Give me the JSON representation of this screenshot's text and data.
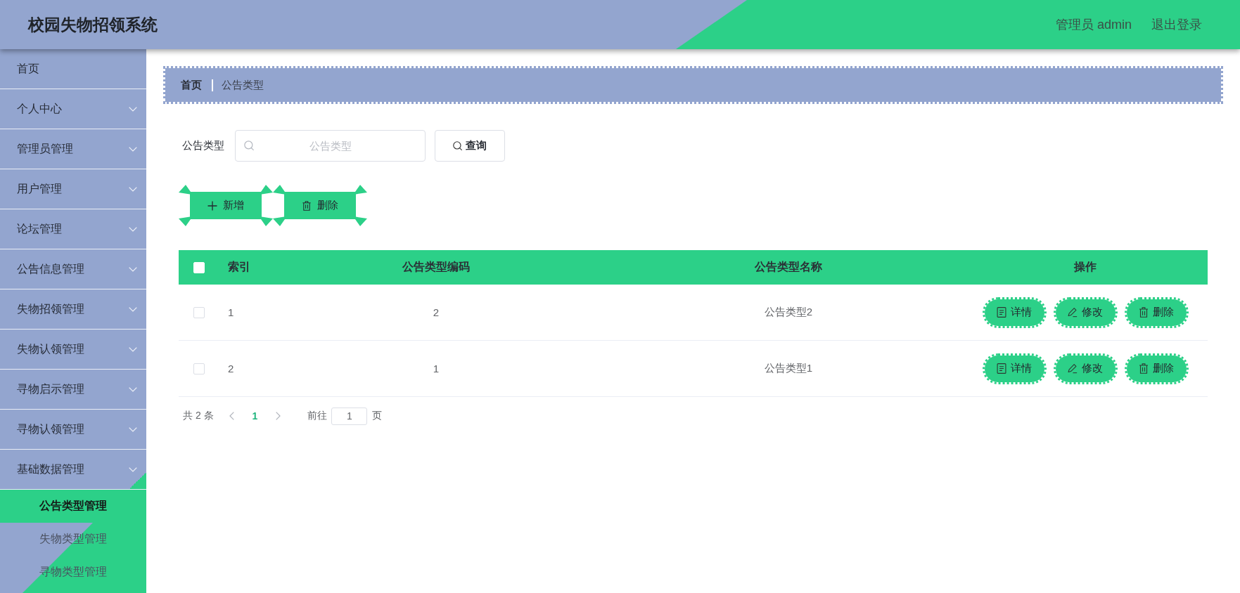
{
  "header": {
    "title": "校园失物招领系统",
    "user": "管理员 admin",
    "logout": "退出登录"
  },
  "sidebar": {
    "items": [
      {
        "label": "首页",
        "kind": "link",
        "selected": false
      },
      {
        "label": "个人中心",
        "kind": "group",
        "selected": false
      },
      {
        "label": "管理员管理",
        "kind": "group",
        "selected": false
      },
      {
        "label": "用户管理",
        "kind": "group",
        "selected": false
      },
      {
        "label": "论坛管理",
        "kind": "group",
        "selected": false
      },
      {
        "label": "公告信息管理",
        "kind": "group",
        "selected": false
      },
      {
        "label": "失物招领管理",
        "kind": "group",
        "selected": false
      },
      {
        "label": "失物认领管理",
        "kind": "group",
        "selected": false
      },
      {
        "label": "寻物启示管理",
        "kind": "group",
        "selected": false
      },
      {
        "label": "寻物认领管理",
        "kind": "group",
        "selected": false
      },
      {
        "label": "基础数据管理",
        "kind": "group",
        "selected": false,
        "children": [
          {
            "label": "公告类型管理",
            "selected": true
          },
          {
            "label": "失物类型管理",
            "selected": false
          },
          {
            "label": "寻物类型管理",
            "selected": false
          }
        ]
      }
    ]
  },
  "breadcrumb": [
    {
      "label": "首页",
      "current": false
    },
    {
      "label": "公告类型",
      "current": true
    }
  ],
  "search": {
    "label": "公告类型",
    "placeholder": "公告类型",
    "button": "查询"
  },
  "toolbar": [
    {
      "label": "新增",
      "kind": "add"
    },
    {
      "label": "删除",
      "kind": "delete"
    }
  ],
  "table": {
    "select_all": {
      "checked": false
    },
    "columns": [
      "索引",
      "公告类型编码",
      "公告类型名称",
      "操作"
    ],
    "rows": [
      {
        "checked": false,
        "index": "1",
        "code": "2",
        "name": "公告类型2",
        "actions": [
          {
            "label": "详情",
            "kind": "detail"
          },
          {
            "label": "修改",
            "kind": "edit"
          },
          {
            "label": "删除",
            "kind": "delete"
          }
        ]
      },
      {
        "checked": false,
        "index": "2",
        "code": "1",
        "name": "公告类型1",
        "actions": [
          {
            "label": "详情",
            "kind": "detail"
          },
          {
            "label": "修改",
            "kind": "edit"
          },
          {
            "label": "删除",
            "kind": "delete"
          }
        ]
      }
    ]
  },
  "pagination": {
    "total": "共 2 条",
    "pages": [
      {
        "label": "1",
        "selected": true
      }
    ],
    "goto_label": "前往",
    "goto_value": "1",
    "suffix": "页"
  }
}
